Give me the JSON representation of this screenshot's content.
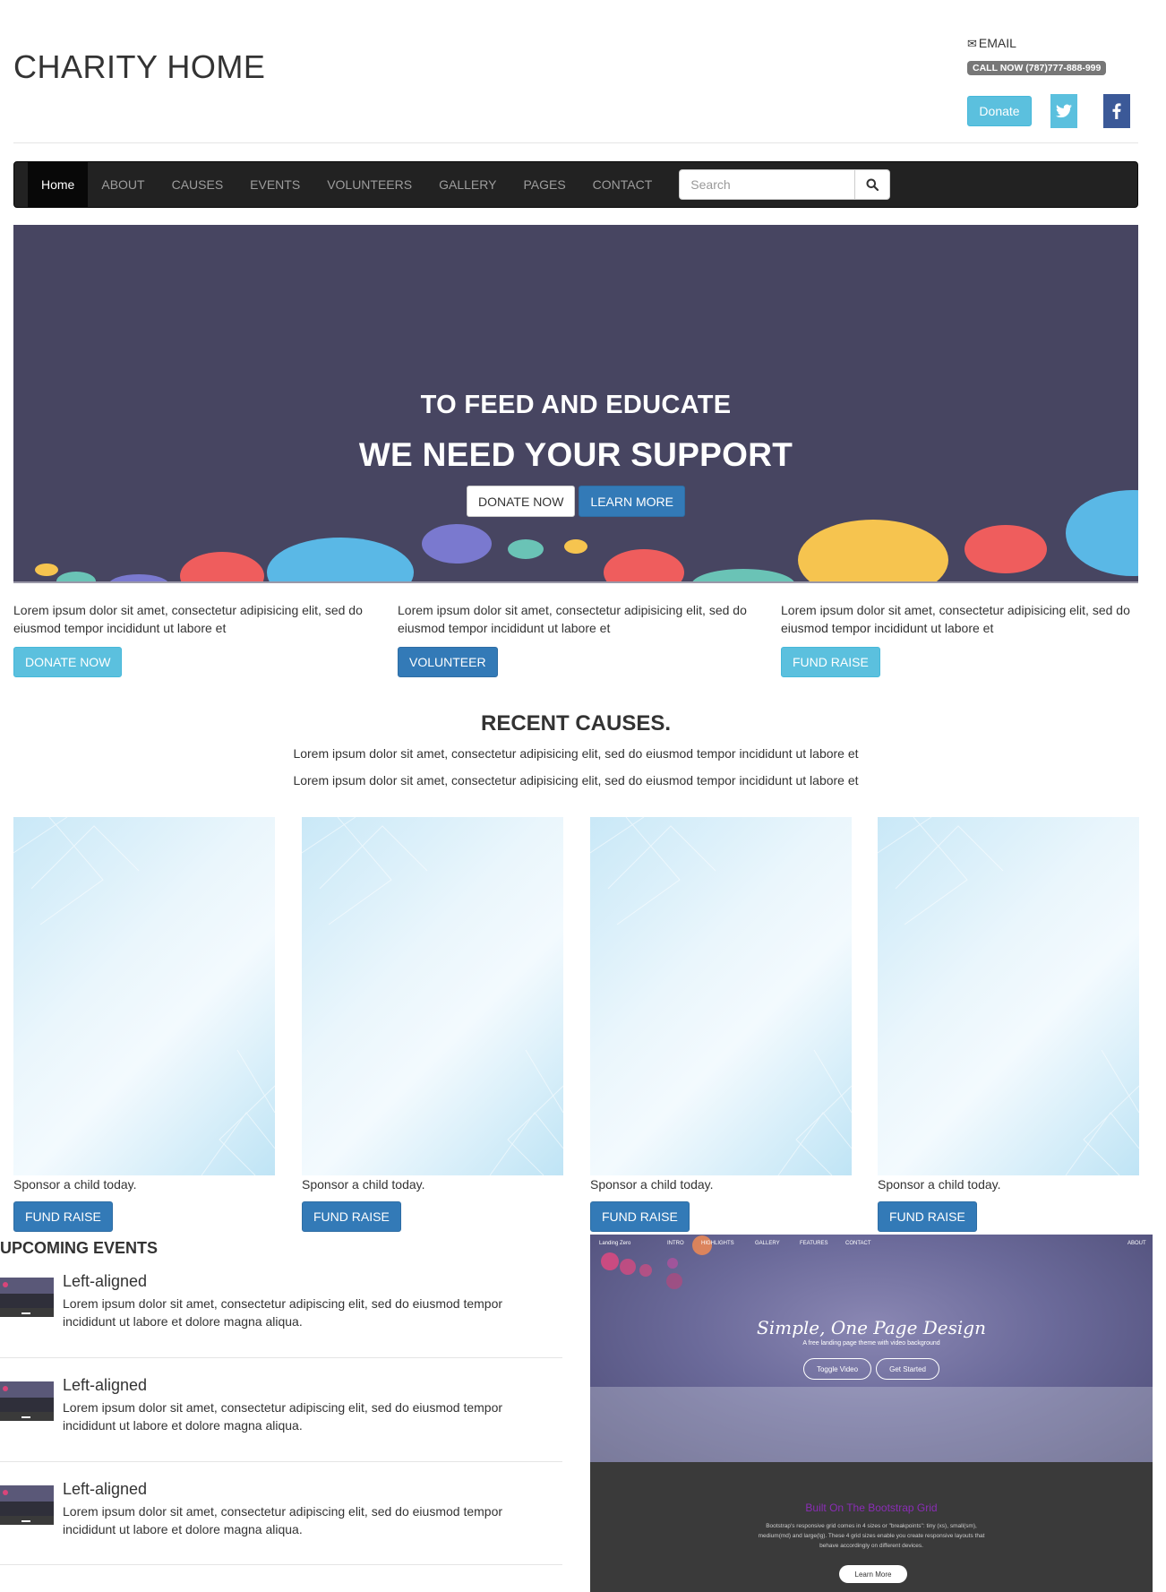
{
  "header": {
    "site_title": "CHARITY HOME",
    "email_label": "EMAIL",
    "call_label": "CALL NOW (787)777-888-999",
    "donate_label": "Donate"
  },
  "nav": {
    "items": [
      "Home",
      "ABOUT",
      "CAUSES",
      "EVENTS",
      "VOLUNTEERS",
      "GALLERY",
      "PAGES",
      "CONTACT"
    ],
    "search_placeholder": "Search"
  },
  "hero": {
    "subtitle": "TO FEED AND EDUCATE",
    "title": "WE NEED YOUR SUPPORT",
    "donate_label": "DONATE NOW",
    "learn_label": "LEARN MORE"
  },
  "features": [
    {
      "text": "Lorem ipsum dolor sit amet, consectetur adipisicing elit, sed do eiusmod tempor incididunt ut labore et",
      "button": "DONATE NOW"
    },
    {
      "text": "Lorem ipsum dolor sit amet, consectetur adipisicing elit, sed do eiusmod tempor incididunt ut labore et",
      "button": "VOLUNTEER"
    },
    {
      "text": "Lorem ipsum dolor sit amet, consectetur adipisicing elit, sed do eiusmod tempor incididunt ut labore et",
      "button": "FUND RAISE"
    }
  ],
  "causes": {
    "title": "RECENT CAUSES.",
    "line1": "Lorem ipsum dolor sit amet, consectetur adipisicing elit, sed do eiusmod tempor incididunt ut labore et",
    "line2": "Lorem ipsum dolor sit amet, consectetur adipisicing elit, sed do eiusmod tempor incididunt ut labore et",
    "cards": [
      {
        "caption": "Sponsor a child today.",
        "button": "FUND RAISE"
      },
      {
        "caption": "Sponsor a child today.",
        "button": "FUND RAISE"
      },
      {
        "caption": "Sponsor a child today.",
        "button": "FUND RAISE"
      },
      {
        "caption": "Sponsor a child today.",
        "button": "FUND RAISE"
      }
    ]
  },
  "events": {
    "title": "UPCOMING EVENTS",
    "items": [
      {
        "heading": "Left-aligned",
        "body": "Lorem ipsum dolor sit amet, consectetur adipiscing elit, sed do eiusmod tempor incididunt ut labore et dolore magna aliqua."
      },
      {
        "heading": "Left-aligned",
        "body": "Lorem ipsum dolor sit amet, consectetur adipiscing elit, sed do eiusmod tempor incididunt ut labore et dolore magna aliqua."
      },
      {
        "heading": "Left-aligned",
        "body": "Lorem ipsum dolor sit amet, consectetur adipiscing elit, sed do eiusmod tempor incididunt ut labore et dolore magna aliqua."
      }
    ]
  },
  "promo": {
    "brand": "Landing Zero",
    "nav": [
      "INTRO",
      "HIGHLIGHTS",
      "GALLERY",
      "FEATURES",
      "CONTACT"
    ],
    "nav_right": "ABOUT",
    "title": "Simple, One Page Design",
    "subtitle": "A free landing page theme with video background",
    "btn1": "Toggle Video",
    "btn2": "Get Started",
    "heading": "Built On The Bootstrap Grid",
    "text": "Bootstrap's responsive grid comes in 4 sizes or \"breakpoints\": tiny (xs), small(sm), medium(md) and large(lg). These 4 grid sizes enable you create responsive layouts that behave accordingly on different devices.",
    "cta": "Learn More"
  },
  "colors": {
    "accent_info": "#5bc0de",
    "accent_primary": "#337ab7",
    "navbar_bg": "#222222",
    "hero_bg": "#474561",
    "facebook": "#3b5998"
  }
}
